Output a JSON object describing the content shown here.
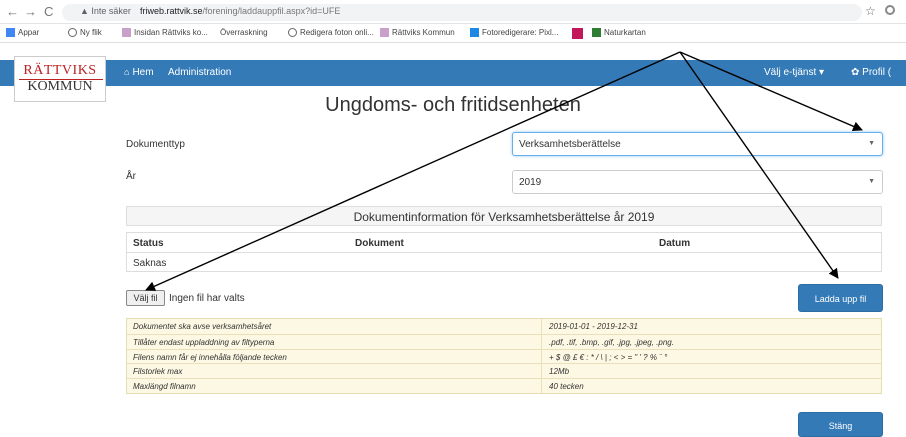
{
  "browser": {
    "back": "←",
    "forward": "→",
    "reload": "C",
    "secure_label": "▲ Inte säker",
    "host": "friweb.rattvik.se",
    "path": "/forening/laddauppfil.aspx?id=UFE",
    "bookmarks": [
      "Appar",
      "Ny flik",
      "Insidan Rättviks ko...",
      "Överraskning",
      "Redigera foton onli...",
      "Rättviks Kommun",
      "Fotoredigerare: Pixl...",
      "Naturkartan"
    ]
  },
  "site": {
    "logo_top": "RÄTTVIKS",
    "logo_bottom": "KOMMUN",
    "nav_home": "Hem",
    "nav_admin": "Administration",
    "nav_service": "Välj e-tjänst ▾",
    "nav_profile": "✿ Profil ("
  },
  "page": {
    "title": "Ungdoms- och fritidsenheten",
    "doc_type_label": "Dokumenttyp",
    "doc_type_value": "Verksamhetsberättelse",
    "year_label": "År",
    "year_value": "2019",
    "info_heading": "Dokumentinformation för Verksamhetsberättelse år 2019",
    "table_headers": [
      "Status",
      "Dokument",
      "Datum"
    ],
    "table_rows": [
      [
        "Saknas",
        "",
        ""
      ]
    ],
    "file_button": "Välj fil",
    "file_status": "Ingen fil har valts",
    "upload_button": "Ladda upp fil",
    "rules": [
      [
        "Dokumentet ska avse verksamhetsåret",
        "2019-01-01 - 2019-12-31"
      ],
      [
        "Tillåter endast uppladdning av filtyperna",
        ".pdf, .tif, .bmp, .gif, .jpg, .jpeg, .png."
      ],
      [
        "Filens namn får ej innehålla följande tecken",
        "+ $ @ £ € : * / \\ | ; < > = \" ' ? % ¨ °"
      ],
      [
        "Filstorlek max",
        "12Mb"
      ],
      [
        "Maxlängd filnamn",
        "40 tecken"
      ]
    ],
    "close_button": "Stäng"
  },
  "colors": {
    "nav": "#337ab7",
    "warning_bg": "#fcf8e3",
    "logo_red": "#b22222"
  }
}
